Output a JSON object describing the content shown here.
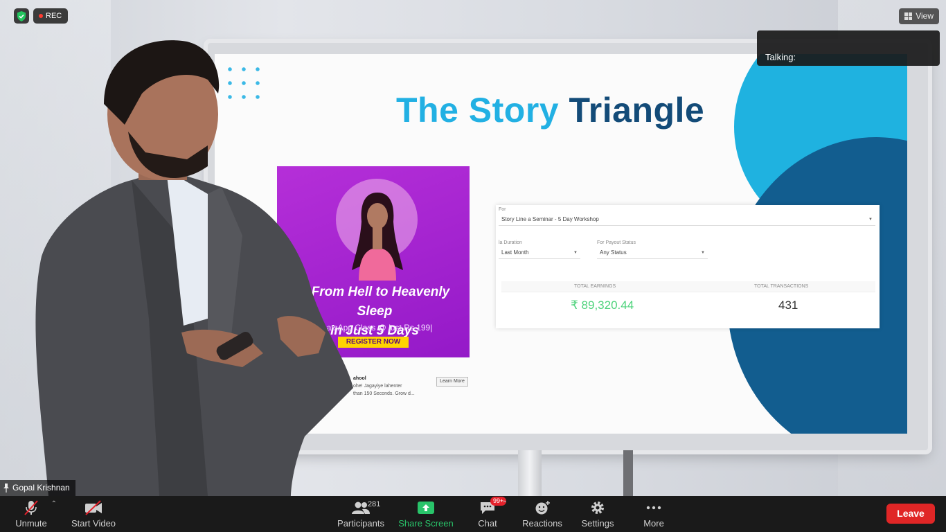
{
  "top_bar": {
    "rec_label": "REC",
    "view_label": "View"
  },
  "talking_label": "Talking:",
  "participant_name": "Gopal Krishnan",
  "slide": {
    "title_part1": "The Story",
    "title_part2": "Triangle",
    "ad": {
      "headline_line1": "o From Hell to Heavenly Sleep",
      "headline_line2": "in Just 5 Days",
      "subline": "WhatsApp Class @ just Rs 199|",
      "cta": "REGISTER NOW",
      "footer_line1": "ahool",
      "footer_line2": "ohe! Jagayiye lahenter",
      "footer_line3": "than 150 Seconds. Grow d...",
      "learn_more": "Learn More"
    },
    "dashboard": {
      "label_for": "For",
      "product_select": "Story Line a Seminar - 5 Day Workshop",
      "label_duration": "la Duration",
      "duration_select": "Last Month",
      "label_payout": "For Payout Status",
      "payout_select": "Any Status",
      "col1_header": "TOTAL EARNINGS",
      "col2_header": "TOTAL TRANSACTIONS",
      "total_earnings": "₹ 89,320.44",
      "total_transactions": "431"
    }
  },
  "toolbar": {
    "unmute": "Unmute",
    "start_video": "Start Video",
    "participants": "Participants",
    "participants_count": "281",
    "share_screen": "Share Screen",
    "chat": "Chat",
    "chat_badge": "99+",
    "reactions": "Reactions",
    "settings": "Settings",
    "more": "More",
    "leave": "Leave"
  },
  "colors": {
    "share_green": "#29c46a",
    "leave_red": "#e02626",
    "title_light": "#22b0e3",
    "title_dark": "#134b78"
  }
}
